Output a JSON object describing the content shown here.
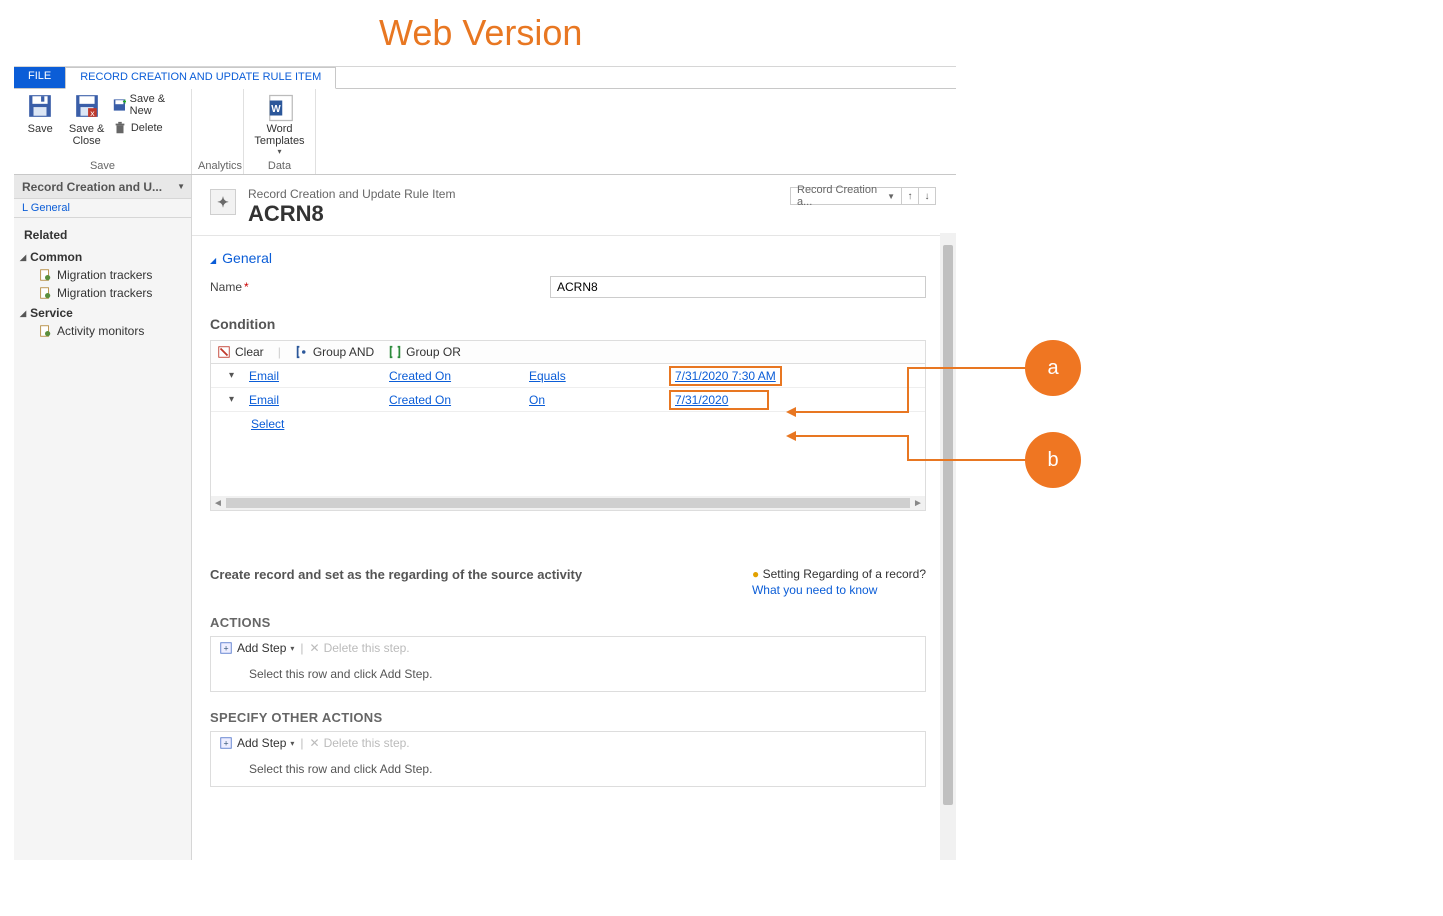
{
  "annotation": {
    "title": "Web Version",
    "a": "a",
    "b": "b"
  },
  "ribbon": {
    "tabs": {
      "file": "FILE",
      "current": "RECORD CREATION AND UPDATE RULE ITEM"
    },
    "save": "Save",
    "save_close": "Save & Close",
    "save_new": "Save & New",
    "delete": "Delete",
    "group_save": "Save",
    "group_analytics": "Analytics",
    "word_templates": "Word Templates",
    "group_data": "Data"
  },
  "leftnav": {
    "header": "Record Creation and U...",
    "selected": "L General",
    "related": "Related",
    "common": "Common",
    "migration1": "Migration trackers",
    "migration2": "Migration trackers",
    "service": "Service",
    "activity": "Activity monitors"
  },
  "form": {
    "breadcrumb": "Record Creation and Update Rule Item",
    "title": "ACRN8",
    "dropdown": "Record Creation a...",
    "section_general": "General",
    "name_label": "Name",
    "name_value": "ACRN8",
    "condition_heading": "Condition",
    "tb_clear": "Clear",
    "tb_group_and": "Group AND",
    "tb_group_or": "Group OR",
    "rows": [
      {
        "entity": "Email",
        "field": "Created On",
        "op": "Equals",
        "value": "7/31/2020 7:30 AM"
      },
      {
        "entity": "Email",
        "field": "Created On",
        "op": "On",
        "value": "7/31/2020"
      }
    ],
    "select": "Select",
    "helper_lead": "Create record and set as the regarding of the source activity",
    "helper_q": "Setting Regarding of a record?",
    "helper_link": "What you need to know",
    "actions_heading": "ACTIONS",
    "add_step": "Add Step",
    "delete_step": "Delete this step.",
    "placeholder_step": "Select this row and click Add Step.",
    "other_heading": "SPECIFY OTHER ACTIONS"
  }
}
